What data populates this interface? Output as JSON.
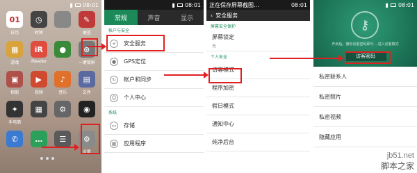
{
  "status": {
    "time": "08:01"
  },
  "panel1": {
    "apps": [
      {
        "label": "日历",
        "icon": "calendar-icon",
        "glyph": "01",
        "color": "#ffffff"
      },
      {
        "label": "时钟",
        "icon": "clock-icon",
        "glyph": "◷",
        "color": "#444444"
      },
      {
        "label": "",
        "icon": "app-icon",
        "glyph": "",
        "color": "#888888"
      },
      {
        "label": "便签",
        "icon": "notes-icon",
        "glyph": "✎",
        "color": "#c03a3a"
      },
      {
        "label": "游戏",
        "icon": "game-icon",
        "glyph": "▦",
        "color": "#d9a23a"
      },
      {
        "label": "iReader",
        "icon": "reader-icon",
        "glyph": "iR",
        "color": "#e04d3f"
      },
      {
        "label": "",
        "icon": "mic-icon",
        "glyph": "●",
        "color": "#3a8a3a"
      },
      {
        "label": "一键锁屏",
        "icon": "lock-icon",
        "glyph": "⊙",
        "color": "#777777"
      },
      {
        "label": "相册",
        "icon": "gallery-icon",
        "glyph": "▣",
        "color": "#b0504a"
      },
      {
        "label": "视频",
        "icon": "video-icon",
        "glyph": "▶",
        "color": "#d04a30"
      },
      {
        "label": "音乐",
        "icon": "music-icon",
        "glyph": "♪",
        "color": "#e0702a"
      },
      {
        "label": "文件",
        "icon": "file-icon",
        "glyph": "▤",
        "color": "#5a6aa0"
      },
      {
        "label": "手电筒",
        "icon": "flashlight-icon",
        "glyph": "✦",
        "color": "#333333"
      },
      {
        "label": "",
        "icon": "film-icon",
        "glyph": "▦",
        "color": "#444444"
      },
      {
        "label": "",
        "icon": "tools-icon",
        "glyph": "⚙",
        "color": "#666666"
      },
      {
        "label": "",
        "icon": "camera-icon",
        "glyph": "◉",
        "color": "#222222"
      },
      {
        "label": "",
        "icon": "phone-icon",
        "glyph": "✆",
        "color": "#3a7ad0"
      },
      {
        "label": "",
        "icon": "message-icon",
        "glyph": "…",
        "color": "#2aa05a"
      },
      {
        "label": "",
        "icon": "contacts-icon",
        "glyph": "☰",
        "color": "#5a5a5a"
      },
      {
        "label": "设置",
        "icon": "settings-icon",
        "glyph": "⚙",
        "color": "#8a8a8a"
      }
    ]
  },
  "panel2": {
    "tabs": [
      "常规",
      "声音",
      "显示"
    ],
    "section1": "帐户与安全",
    "items1": [
      {
        "label": "安全服务",
        "icon": "shield-icon",
        "glyph": "+"
      },
      {
        "label": "GPS定位",
        "icon": "location-icon",
        "glyph": "●"
      },
      {
        "label": "帐户和同步",
        "icon": "sync-icon",
        "glyph": "↻"
      },
      {
        "label": "个人中心",
        "icon": "person-icon",
        "glyph": "☺"
      }
    ],
    "section2": "系统",
    "items2": [
      {
        "label": "存储",
        "icon": "storage-icon",
        "glyph": "▭"
      },
      {
        "label": "应用程序",
        "icon": "apps-icon",
        "glyph": "▦"
      }
    ]
  },
  "panel3": {
    "status_title": "正在保存屏幕截图...",
    "header": "安全服务",
    "section1": "屏幕安全保护",
    "lock": {
      "label": "屏幕锁定",
      "sub": "无"
    },
    "section2": "个人安全",
    "items": [
      "访客模式",
      "程序加密",
      "假日模式",
      "通知中心",
      "纯净后台"
    ]
  },
  "panel4": {
    "hint": "开启后，拥有访客密码即可... 进入访客模式",
    "button": "访客密码",
    "items": [
      "私密联系人",
      "私密照片",
      "私密视频",
      "隐藏应用"
    ]
  },
  "watermark": {
    "line1": "jb51.net",
    "line2": "脚本之家"
  }
}
